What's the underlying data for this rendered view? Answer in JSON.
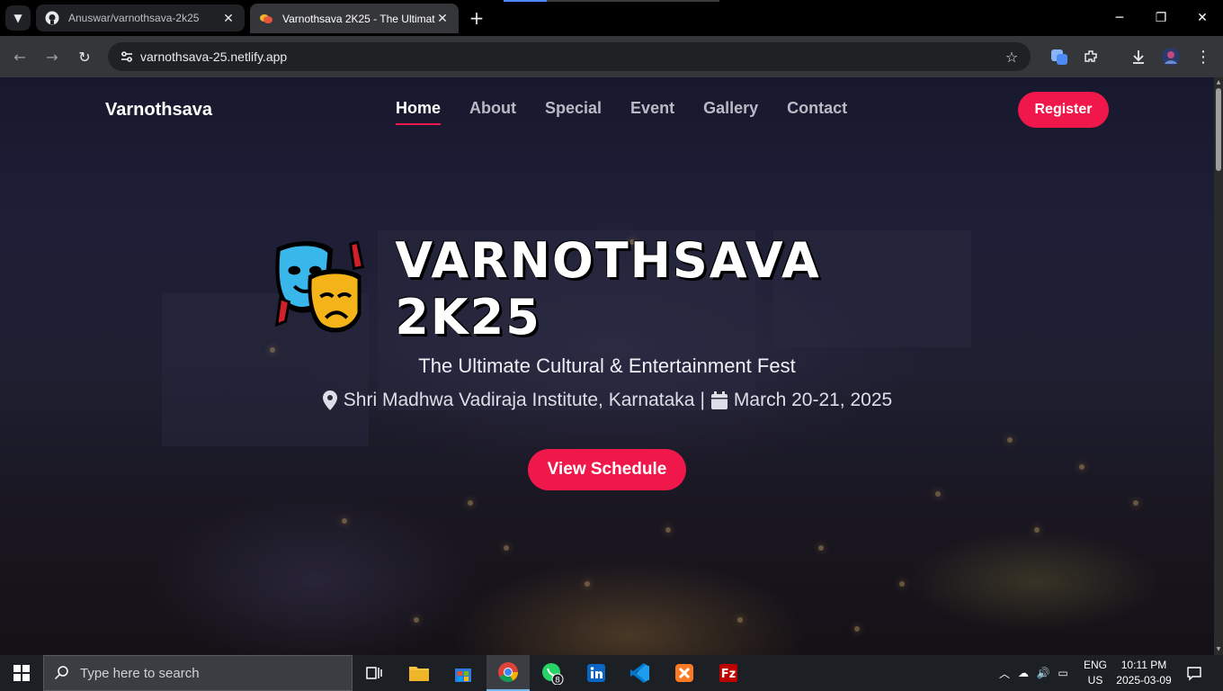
{
  "browser": {
    "tabs": [
      {
        "title": "Anuswar/varnothsava-2k25",
        "favicon": "github-icon",
        "active": false
      },
      {
        "title": "Varnothsava 2K25 - The Ultimat",
        "favicon": "masks-favicon",
        "active": true
      }
    ],
    "url": "varnothsava-25.netlify.app"
  },
  "site": {
    "brand": "Varnothsava",
    "nav": [
      "Home",
      "About",
      "Special",
      "Event",
      "Gallery",
      "Contact"
    ],
    "active_nav": "Home",
    "register_label": "Register",
    "hero": {
      "title": "VARNOTHSAVA 2K25",
      "subtitle": "The Ultimate Cultural & Entertainment Fest",
      "location": "Shri Madhwa Vadiraja Institute, Karnataka",
      "separator": "|",
      "date": "March 20-21, 2025",
      "button_label": "View Schedule"
    },
    "accent_color": "#f0184a"
  },
  "taskbar": {
    "search_placeholder": "Type here to search",
    "whatsapp_badge": "8",
    "language": {
      "line1": "ENG",
      "line2": "US"
    },
    "time": "10:11 PM",
    "date": "2025-03-09"
  }
}
